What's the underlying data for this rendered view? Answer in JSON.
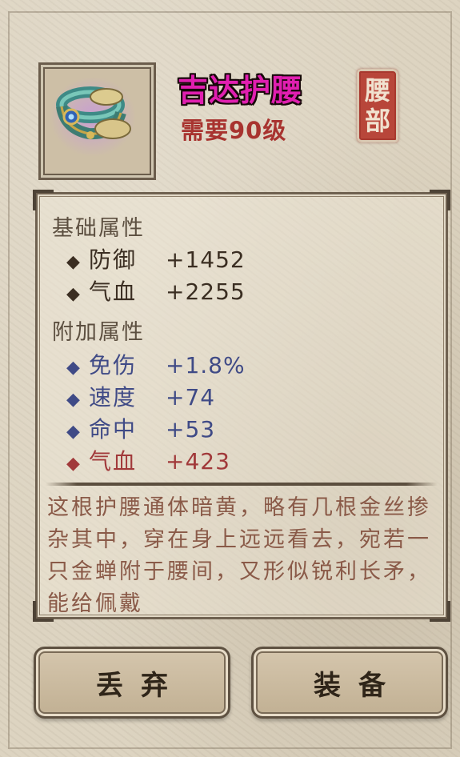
{
  "item": {
    "name": "吉达护腰",
    "level_requirement": "需要90级",
    "slot_seal": [
      "腰",
      "部"
    ],
    "icon": "jade-belt-icon"
  },
  "base_attributes": {
    "title": "基础属性",
    "stats": [
      {
        "name": "防御",
        "value": "+1452"
      },
      {
        "name": "气血",
        "value": "+2255"
      }
    ]
  },
  "extra_attributes": {
    "title": "附加属性",
    "stats": [
      {
        "name": "免伤",
        "value": "+1.8%"
      },
      {
        "name": "速度",
        "value": "+74"
      },
      {
        "name": "命中",
        "value": "+53"
      },
      {
        "name": "气血",
        "value": "+423"
      }
    ]
  },
  "description": "这根护腰通体暗黄，略有几根金丝掺杂其中，穿在身上远远看去，宛若一只金蝉附于腰间，又形似锐利长矛，能给佩戴",
  "buttons": {
    "discard": "丢弃",
    "equip": "装备"
  },
  "colors": {
    "item_name": "#e01fb0",
    "level_requirement": "#a8332f",
    "base_stat": "#3b2e22",
    "extra_stat": "#3f4a86",
    "special_stat": "#a1393a",
    "description": "#8a5a48",
    "seal": "#b8463a"
  }
}
